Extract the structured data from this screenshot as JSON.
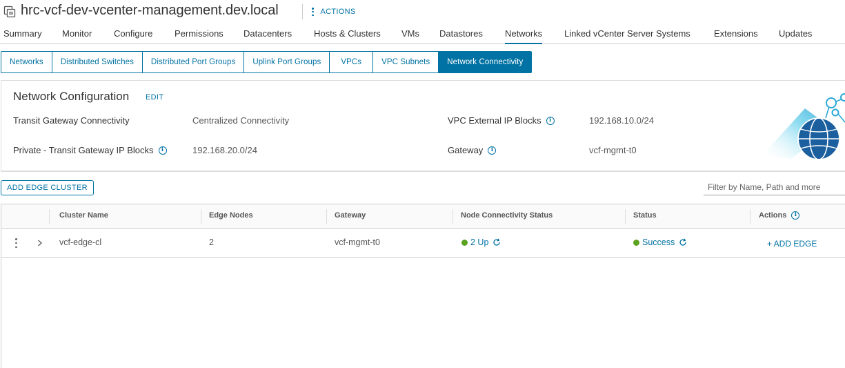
{
  "header": {
    "title": "hrc-vcf-dev-vcenter-management.dev.local",
    "actions_label": "ACTIONS",
    "icon": "vcenter-icon"
  },
  "main_tabs": [
    {
      "label": "Summary"
    },
    {
      "label": "Monitor"
    },
    {
      "label": "Configure"
    },
    {
      "label": "Permissions"
    },
    {
      "label": "Datacenters"
    },
    {
      "label": "Hosts & Clusters"
    },
    {
      "label": "VMs"
    },
    {
      "label": "Datastores"
    },
    {
      "label": "Networks",
      "active": true
    },
    {
      "label": "Linked vCenter Server Systems"
    },
    {
      "label": "Extensions"
    },
    {
      "label": "Updates"
    }
  ],
  "sub_tabs": [
    {
      "label": "Networks"
    },
    {
      "label": "Distributed Switches"
    },
    {
      "label": "Distributed Port Groups"
    },
    {
      "label": "Uplink Port Groups"
    },
    {
      "label": "VPCs"
    },
    {
      "label": "VPC Subnets"
    },
    {
      "label": "Network Connectivity",
      "active": true
    }
  ],
  "config": {
    "title": "Network Configuration",
    "edit_label": "EDIT",
    "transit_label": "Transit Gateway Connectivity",
    "transit_value": "Centralized Connectivity",
    "private_label": "Private - Transit Gateway IP Blocks",
    "private_value": "192.168.20.0/24",
    "vpc_label": "VPC External IP Blocks",
    "vpc_value": "192.168.10.0/24",
    "gateway_label": "Gateway",
    "gateway_value": "vcf-mgmt-t0"
  },
  "toolbar": {
    "add_edge_cluster_label": "ADD EDGE CLUSTER",
    "filter_placeholder": "Filter by Name, Path and more"
  },
  "grid": {
    "columns": [
      "Cluster Name",
      "Edge Nodes",
      "Gateway",
      "Node Connectivity Status",
      "Status",
      "Actions"
    ],
    "rows": [
      {
        "cluster_name": "vcf-edge-cl",
        "edge_nodes": "2",
        "gateway": "vcf-mgmt-t0",
        "node_connectivity": "2 Up",
        "status": "Success",
        "action": "+ ADD EDGE"
      }
    ]
  },
  "colors": {
    "accent": "#0072a3",
    "success": "#5aa220",
    "text": "#333333"
  }
}
